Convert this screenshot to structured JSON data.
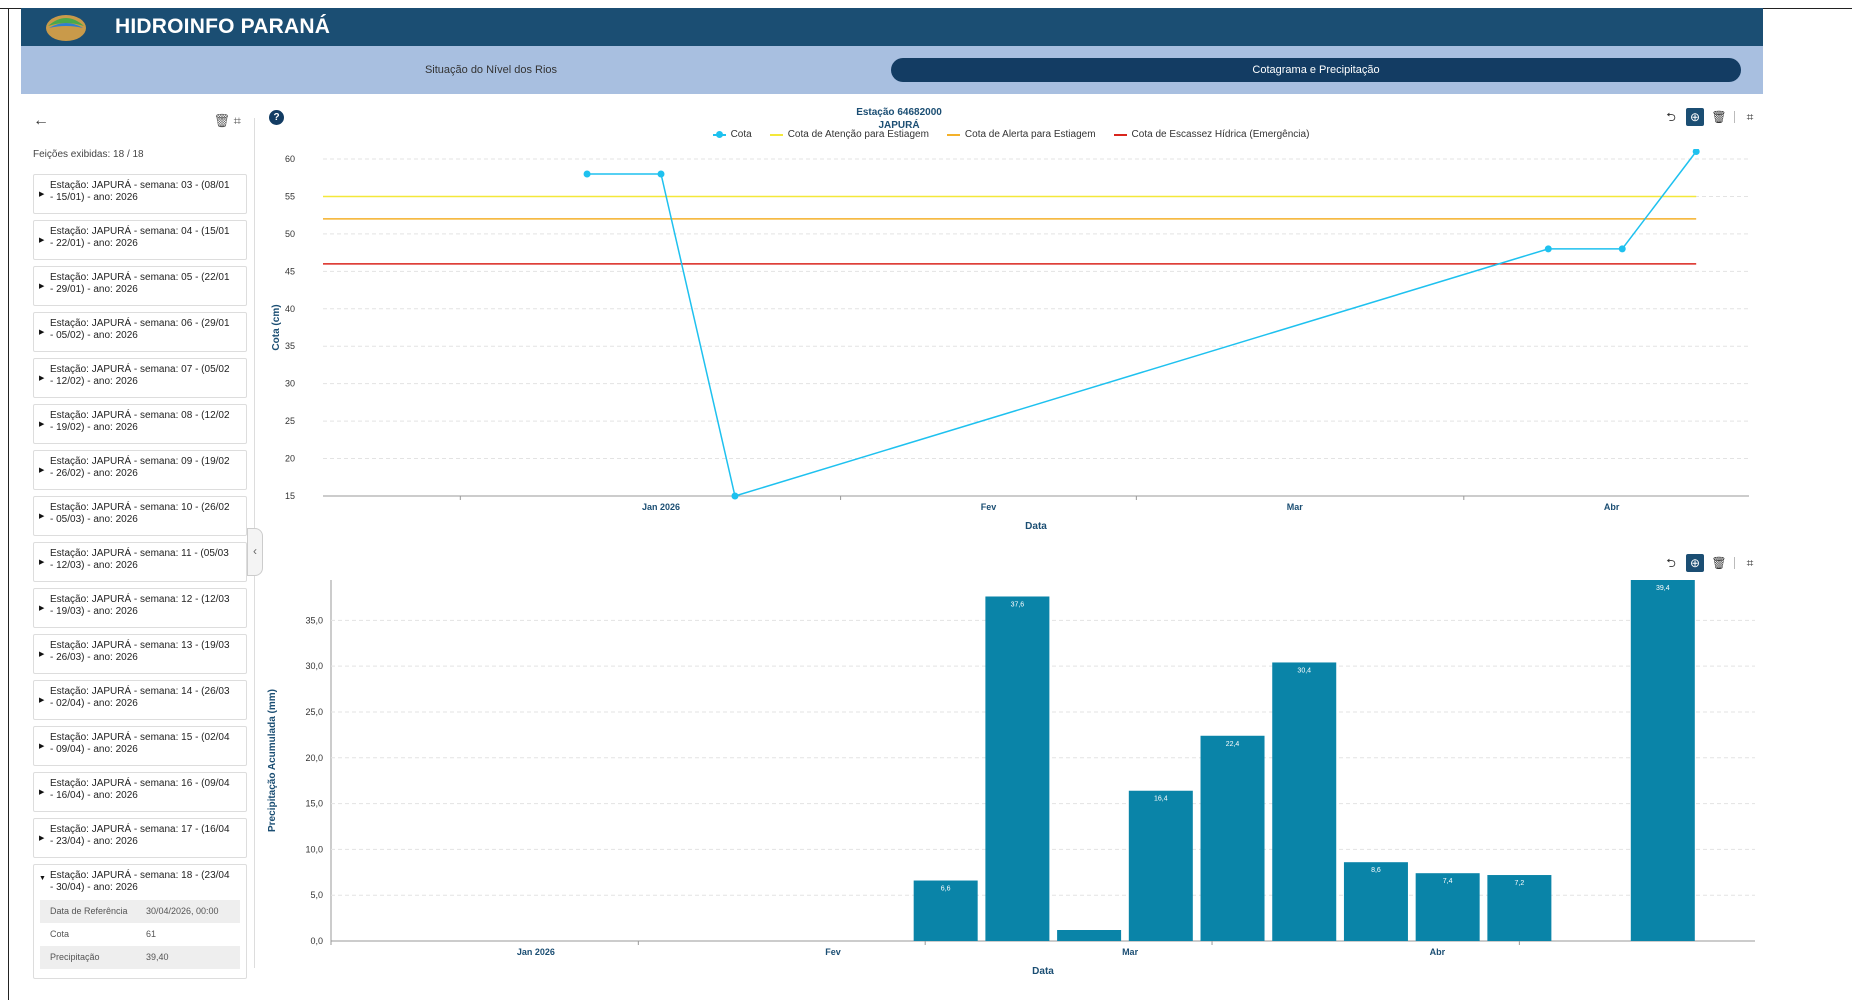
{
  "app": {
    "title": "HIDROINFO PARANÁ"
  },
  "tabs": [
    {
      "label": "Situação do Nível dos Rios",
      "active": false
    },
    {
      "label": "Cotagrama e Precipitação",
      "active": true
    }
  ],
  "sidebar": {
    "feicoes": "Feições exibidas: 18 / 18",
    "items": [
      {
        "line1": "Estação: JAPURÁ - semana: 03 - (08/01",
        "line2": "- 15/01) - ano: 2026"
      },
      {
        "line1": "Estação: JAPURÁ - semana: 04 - (15/01",
        "line2": "- 22/01) - ano: 2026"
      },
      {
        "line1": "Estação: JAPURÁ - semana: 05 - (22/01",
        "line2": "- 29/01) - ano: 2026"
      },
      {
        "line1": "Estação: JAPURÁ - semana: 06 - (29/01",
        "line2": "- 05/02) - ano: 2026"
      },
      {
        "line1": "Estação: JAPURÁ - semana: 07 - (05/02",
        "line2": "- 12/02) - ano: 2026"
      },
      {
        "line1": "Estação: JAPURÁ - semana: 08 - (12/02",
        "line2": "- 19/02) - ano: 2026"
      },
      {
        "line1": "Estação: JAPURÁ - semana: 09 - (19/02",
        "line2": "- 26/02) - ano: 2026"
      },
      {
        "line1": "Estação: JAPURÁ - semana: 10 - (26/02",
        "line2": "- 05/03) - ano: 2026"
      },
      {
        "line1": "Estação: JAPURÁ - semana: 11 - (05/03",
        "line2": "- 12/03) - ano: 2026"
      },
      {
        "line1": "Estação: JAPURÁ - semana: 12 - (12/03",
        "line2": "- 19/03) - ano: 2026"
      },
      {
        "line1": "Estação: JAPURÁ - semana: 13 - (19/03",
        "line2": "- 26/03) - ano: 2026"
      },
      {
        "line1": "Estação: JAPURÁ - semana: 14 - (26/03",
        "line2": "- 02/04) - ano: 2026"
      },
      {
        "line1": "Estação: JAPURÁ - semana: 15 - (02/04",
        "line2": "- 09/04) - ano: 2026"
      },
      {
        "line1": "Estação: JAPURÁ - semana: 16 - (09/04",
        "line2": "- 16/04) - ano: 2026"
      },
      {
        "line1": "Estação: JAPURÁ - semana: 17 - (16/04",
        "line2": "- 23/04) - ano: 2026"
      }
    ],
    "open_item": {
      "line1": "Estação: JAPURÁ - semana: 18 - (23/04",
      "line2": "- 30/04) - ano: 2026",
      "rows": [
        {
          "k": "Data de Referência",
          "v": "30/04/2026, 00:00"
        },
        {
          "k": "Cota",
          "v": "61"
        },
        {
          "k": "Precipitação",
          "v": "39,40"
        }
      ]
    }
  },
  "icons": {
    "back": "arrow-left-icon",
    "trash": "trash-icon",
    "grid": "grid-icon",
    "help": "help-icon",
    "reset": "reset-zoom-icon",
    "zoom": "zoom-icon",
    "restore": "restore-icon"
  },
  "glyphs": {
    "back": "←",
    "trash": "🗑",
    "grid": "⌗",
    "help": "?",
    "collapse": "‹",
    "reset": "⮌",
    "zoom": "⊕",
    "restore": "🗑"
  },
  "colors": {
    "header": "#1b4e73",
    "tabs_bg": "#a8bfe0",
    "cota": "#1ec1ef",
    "atencao": "#f4e83a",
    "alerta": "#f4b12a",
    "escassez": "#d9251d",
    "bars": "#0a84a8"
  },
  "chart_data": [
    {
      "type": "line",
      "title": "Estação 64682000",
      "subtitle": "JAPURÁ",
      "xlabel": "Data",
      "ylabel": "Cota (cm)",
      "x_ticks": [
        "Jan 2026",
        "Fev",
        "Mar",
        "Abr"
      ],
      "y_ticks": [
        "15",
        "20",
        "25",
        "30",
        "35",
        "40",
        "45",
        "50",
        "55",
        "60"
      ],
      "ylim": [
        15,
        60
      ],
      "x": [
        "2026-01-08",
        "2026-01-15",
        "2026-01-22",
        "2026-04-09",
        "2026-04-16",
        "2026-04-23"
      ],
      "series": [
        {
          "name": "Cota",
          "values": [
            58,
            58,
            15,
            48,
            48,
            61
          ]
        }
      ],
      "thresholds": [
        {
          "name": "Cota de Atenção para Estiagem",
          "value": 55,
          "color": "#f4e83a"
        },
        {
          "name": "Cota de Alerta para Estiagem",
          "value": 52,
          "color": "#f4b12a"
        },
        {
          "name": "Cota de Escassez Hídrica (Emergência)",
          "value": 46,
          "color": "#d9251d"
        }
      ],
      "grid": true,
      "legend": "top-center"
    },
    {
      "type": "bar",
      "xlabel": "Data",
      "ylabel": "Precipitação Acumulada (mm)",
      "x_ticks": [
        "Jan 2026",
        "Fev",
        "Mar",
        "Abr"
      ],
      "y_ticks": [
        "0,0",
        "5,0",
        "10,0",
        "15,0",
        "20,0",
        "25,0",
        "30,0",
        "35,0"
      ],
      "ylim": [
        0,
        39.4
      ],
      "x": [
        "2026-01-08",
        "2026-01-15",
        "2026-01-22",
        "2026-01-29",
        "2026-02-05",
        "2026-02-12",
        "2026-02-19",
        "2026-02-26",
        "2026-03-05",
        "2026-03-12",
        "2026-03-19",
        "2026-03-26",
        "2026-04-02",
        "2026-04-09",
        "2026-04-16",
        "2026-04-23"
      ],
      "values": [
        0,
        0,
        0,
        0,
        0,
        6.6,
        37.6,
        1.2,
        16.4,
        22.4,
        30.4,
        8.6,
        7.4,
        7.2,
        0,
        39.4
      ],
      "labels": [
        "",
        "",
        "",
        "",
        "",
        "6,6",
        "37,6",
        "",
        "16,4",
        "22,4",
        "30,4",
        "8,6",
        "7,4",
        "7,2",
        "",
        "39,4"
      ],
      "grid": true
    }
  ]
}
